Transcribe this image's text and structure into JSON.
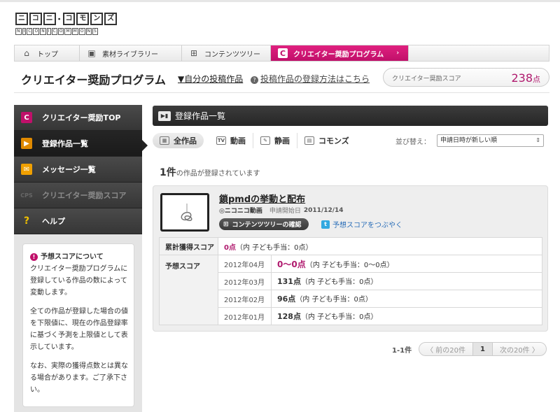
{
  "logo": {
    "top_chars": [
      "ニ",
      "コ",
      "ニ",
      "・",
      "コ",
      "モ",
      "ン",
      "ズ"
    ],
    "sub_chars": [
      "N",
      "I",
      "C",
      "O",
      "N",
      "I",
      "C",
      "O",
      "M",
      "M",
      "O",
      "N",
      "S"
    ]
  },
  "tabs": [
    {
      "label": "トップ",
      "icon": "home-icon"
    },
    {
      "label": "素材ライブラリー",
      "icon": "library-icon"
    },
    {
      "label": "コンテンツツリー",
      "icon": "tree-icon"
    },
    {
      "label": "クリエイター奨励プログラム",
      "icon": "c-logo-icon",
      "active": true
    }
  ],
  "header": {
    "title": "クリエイター奨励プログラム",
    "my_posts": "▼自分の投稿作品",
    "howto": "投稿作品の登録方法はこちら",
    "score_label": "クリエイター奨励スコア",
    "score_value": "238",
    "score_unit": "点"
  },
  "sidebar": {
    "items": [
      {
        "label": "クリエイター奨励TOP",
        "icon": "c-logo-icon"
      },
      {
        "label": "登録作品一覧",
        "icon": "film-icon",
        "active": true
      },
      {
        "label": "メッセージ一覧",
        "icon": "message-icon"
      },
      {
        "label": "クリエイター奨励スコア",
        "icon": "cps-icon",
        "disabled": true
      },
      {
        "label": "ヘルプ",
        "icon": "help-icon"
      }
    ],
    "info": {
      "title": "予想スコアについて",
      "p1": "クリエイター奨励プログラムに登録している作品の数によって変動します。",
      "p2": "全ての作品が登録した場合の値を下限値に、現在の作品登録率に基づく予測を上限値として表示しています。",
      "p3": "なお、実際の獲得点数とは異なる場合があります。ご了承下さい。"
    }
  },
  "main": {
    "heading": "登録作品一覧",
    "filters": [
      "全作品",
      "動画",
      "静画",
      "コモンズ"
    ],
    "sort_label": "並び替え：",
    "sort_value": "申請日時が新しい順",
    "count": "1件",
    "count_suffix": "の作品が登録されています"
  },
  "work": {
    "title": "鎖pmdの挙動と配布",
    "service": "ニコニコ動画",
    "date_label": "申請開始日",
    "date": "2011/12/14",
    "tree_button": "コンテンツツリーの確認",
    "tweet": "予想スコアをつぶやく",
    "earned_label": "累計獲得スコア",
    "earned_value": "0点",
    "earned_note": "（内 子ども手当：0点）",
    "forecast_label": "予想スコア",
    "forecast": [
      {
        "month": "2012年04月",
        "value": "0〜0点",
        "note": "（内 子ども手当：0〜0点）"
      },
      {
        "month": "2012年03月",
        "value": "131点",
        "note": "（内 子ども手当：0点）"
      },
      {
        "month": "2012年02月",
        "value": "96点",
        "note": "（内 子ども手当：0点）"
      },
      {
        "month": "2012年01月",
        "value": "128点",
        "note": "（内 子ども手当：0点）"
      }
    ]
  },
  "pager": {
    "range": "1-1件",
    "prev": "〈 前の20件",
    "current": "1",
    "next": "次の20件 〉"
  },
  "colors": {
    "accent": "#c0106a",
    "score": "#b01a6e",
    "dark": "#2a2a2a"
  }
}
